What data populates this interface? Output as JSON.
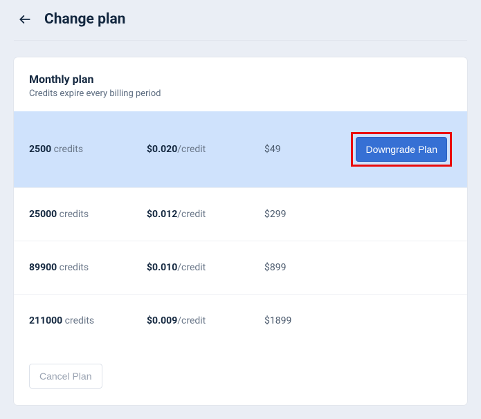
{
  "header": {
    "title": "Change plan"
  },
  "section": {
    "title": "Monthly plan",
    "subtitle": "Credits expire every billing period"
  },
  "credits_label": "credits",
  "rate_label": "/credit",
  "plans": [
    {
      "credits": "2500",
      "rate": "$0.020",
      "price": "$49",
      "action": "Downgrade Plan",
      "selected": true
    },
    {
      "credits": "25000",
      "rate": "$0.012",
      "price": "$299",
      "action": null,
      "selected": false
    },
    {
      "credits": "89900",
      "rate": "$0.010",
      "price": "$899",
      "action": null,
      "selected": false
    },
    {
      "credits": "211000",
      "rate": "$0.009",
      "price": "$1899",
      "action": null,
      "selected": false
    }
  ],
  "cancel_label": "Cancel Plan"
}
